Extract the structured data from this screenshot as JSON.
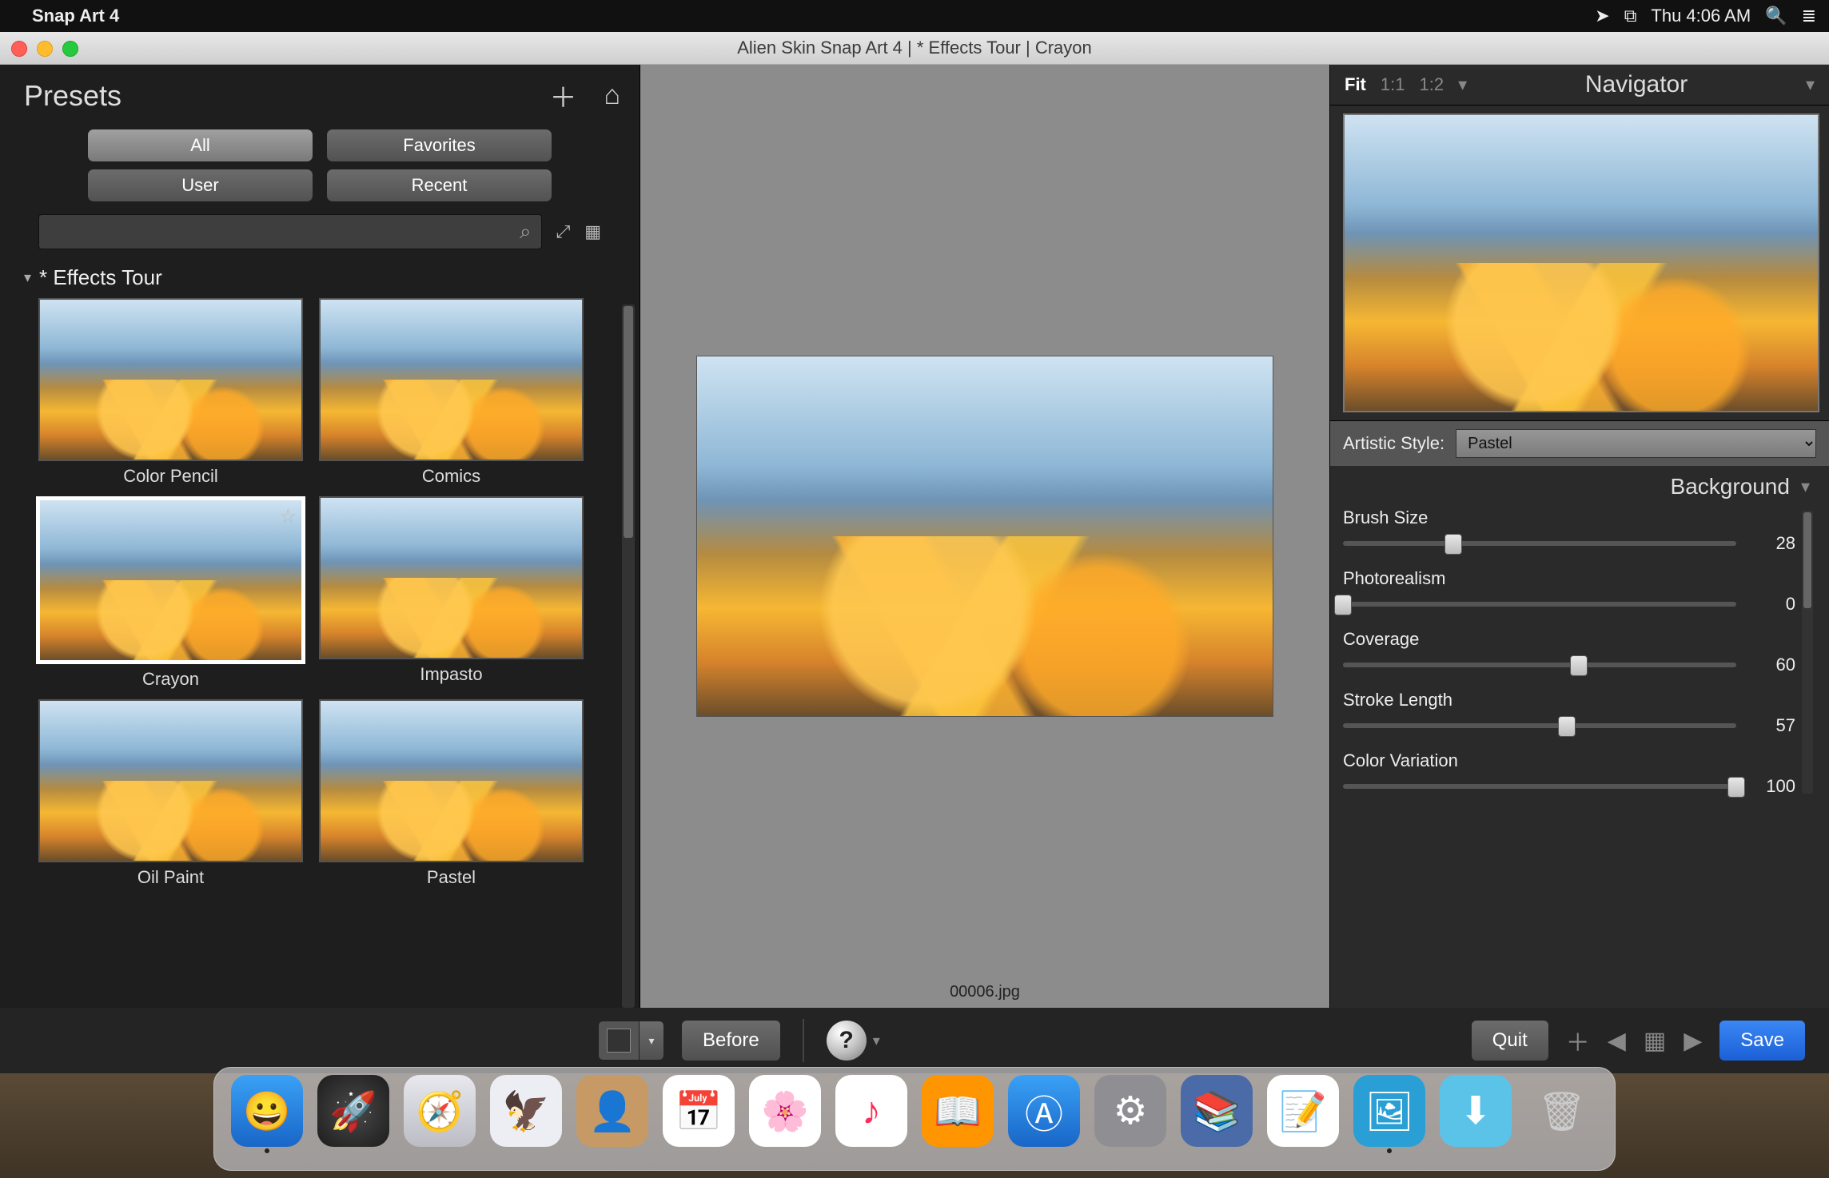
{
  "menubar": {
    "app_name": "Snap Art 4",
    "clock": "Thu 4:06 AM"
  },
  "window": {
    "title": "Alien Skin Snap Art 4 | * Effects Tour | Crayon"
  },
  "presets": {
    "title": "Presets",
    "filters": {
      "all": "All",
      "favorites": "Favorites",
      "user": "User",
      "recent": "Recent"
    },
    "group_title": "* Effects Tour",
    "thumbs": [
      {
        "label": "Color Pencil",
        "selected": false
      },
      {
        "label": "Comics",
        "selected": false
      },
      {
        "label": "Crayon",
        "selected": true
      },
      {
        "label": "Impasto",
        "selected": false
      },
      {
        "label": "Oil Paint",
        "selected": false
      },
      {
        "label": "Pastel",
        "selected": false
      }
    ]
  },
  "canvas": {
    "filename": "00006.jpg"
  },
  "navigator": {
    "title": "Navigator",
    "zoom": {
      "fit": "Fit",
      "one": "1:1",
      "half": "1:2"
    },
    "style_label": "Artistic Style:",
    "style_value": "Pastel",
    "section": "Background",
    "sliders": [
      {
        "label": "Brush Size",
        "value": 28
      },
      {
        "label": "Photorealism",
        "value": 0
      },
      {
        "label": "Coverage",
        "value": 60
      },
      {
        "label": "Stroke Length",
        "value": 57
      },
      {
        "label": "Color Variation",
        "value": 100
      }
    ]
  },
  "bottom": {
    "before": "Before",
    "quit": "Quit",
    "save": "Save"
  }
}
